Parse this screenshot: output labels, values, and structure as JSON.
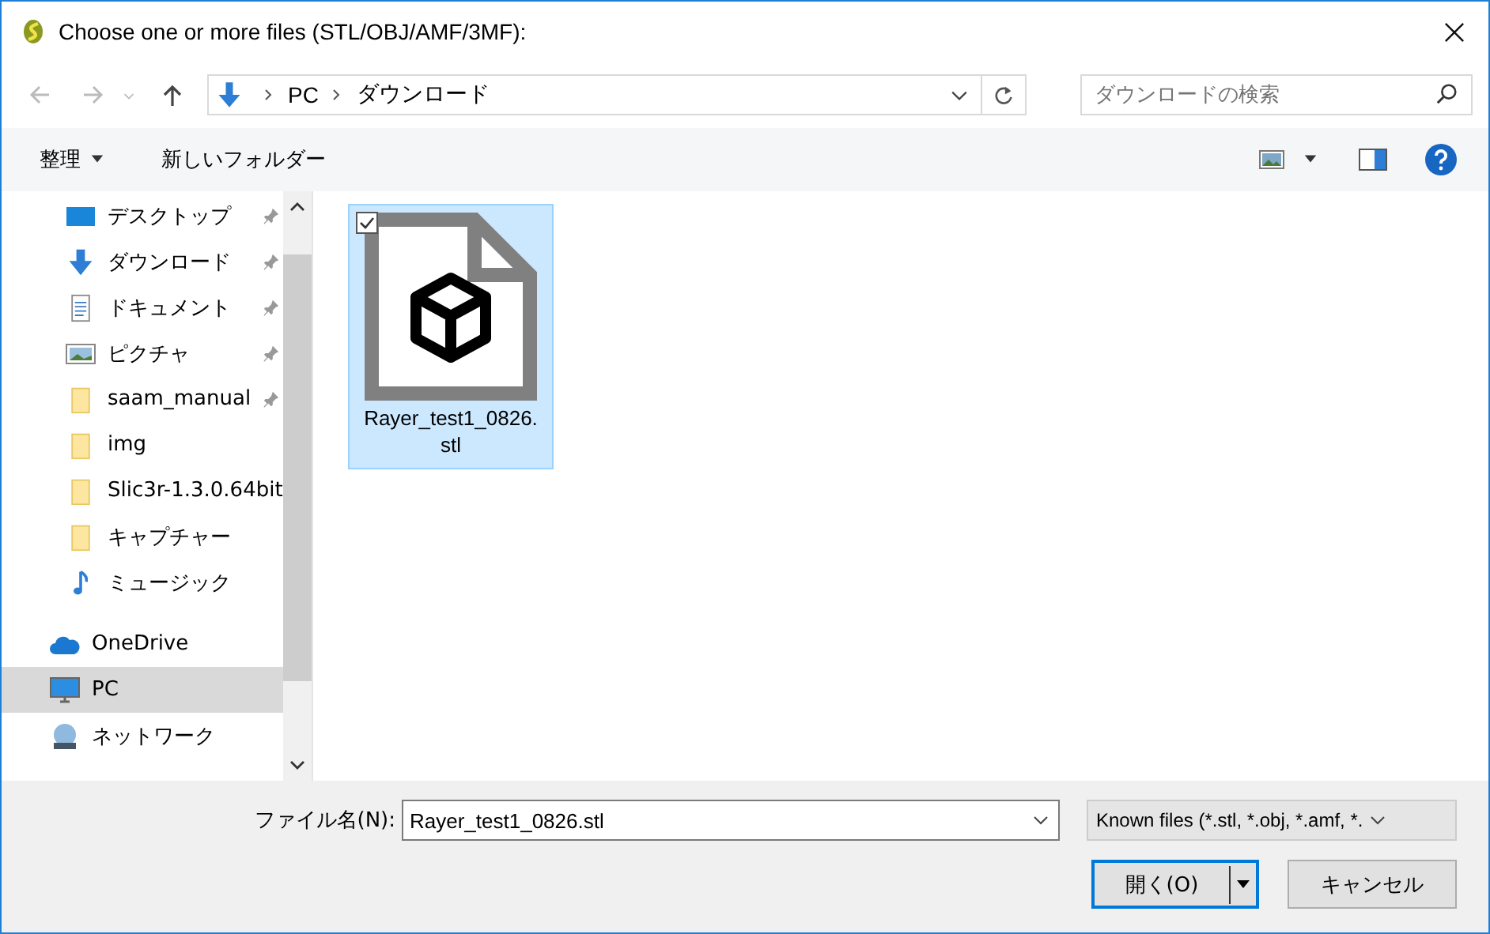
{
  "window": {
    "title": "Choose one or more files (STL/OBJ/AMF/3MF):"
  },
  "address": {
    "segments": [
      "PC",
      "ダウンロード"
    ]
  },
  "search": {
    "placeholder": "ダウンロードの検索"
  },
  "toolbar": {
    "organize": "整理",
    "new_folder": "新しいフォルダー"
  },
  "sidebar": {
    "items": [
      {
        "label": "デスクトップ",
        "kind": "desktop",
        "pinned": true,
        "selected": false
      },
      {
        "label": "ダウンロード",
        "kind": "download",
        "pinned": true,
        "selected": false
      },
      {
        "label": "ドキュメント",
        "kind": "document",
        "pinned": true,
        "selected": false
      },
      {
        "label": "ピクチャ",
        "kind": "picture",
        "pinned": true,
        "selected": false
      },
      {
        "label": "saam_manual",
        "kind": "folder",
        "pinned": true,
        "selected": false
      },
      {
        "label": "img",
        "kind": "folder",
        "pinned": false,
        "selected": false
      },
      {
        "label": "Slic3r-1.3.0.64bit",
        "kind": "folder",
        "pinned": false,
        "selected": false
      },
      {
        "label": "キャプチャー",
        "kind": "folder",
        "pinned": false,
        "selected": false
      },
      {
        "label": "ミュージック",
        "kind": "music",
        "pinned": false,
        "selected": false
      },
      {
        "label": "OneDrive",
        "kind": "cloud",
        "pinned": false,
        "selected": false
      },
      {
        "label": "PC",
        "kind": "pc",
        "pinned": false,
        "selected": true
      },
      {
        "label": "ネットワーク",
        "kind": "network",
        "pinned": false,
        "selected": false
      }
    ]
  },
  "files": [
    {
      "name": "Rayer_test1_0826.stl",
      "selected": true,
      "checked": true
    }
  ],
  "footer": {
    "filename_label": "ファイル名(N):",
    "filename": "Rayer_test1_0826.stl",
    "filter": "Known files (*.stl, *.obj, *.amf, *.",
    "open": "開く(O)",
    "cancel": "キャンセル"
  }
}
